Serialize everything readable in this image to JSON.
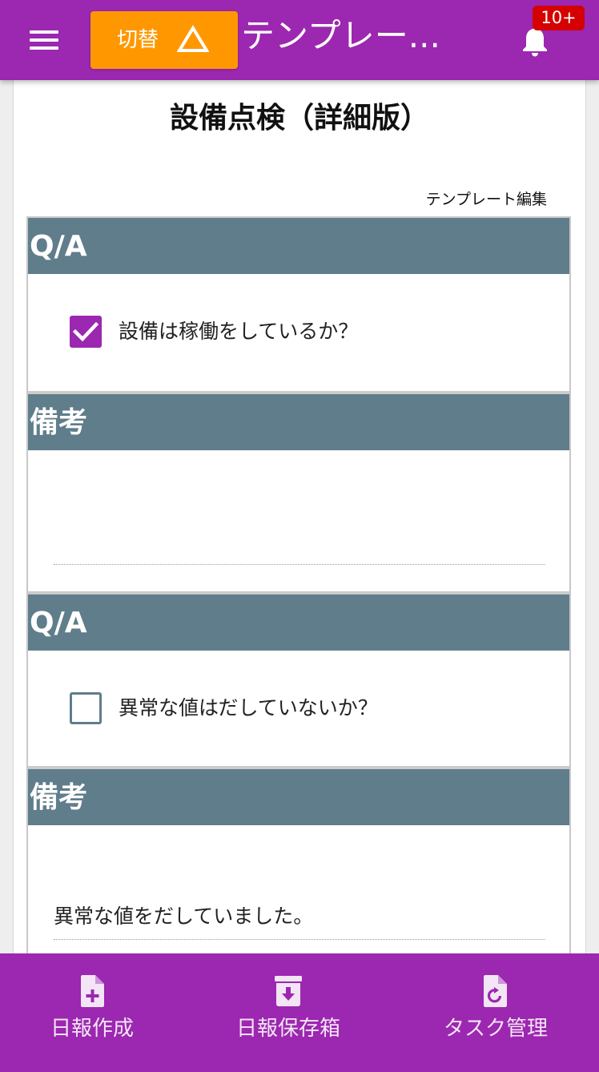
{
  "header": {
    "switch_label": "切替",
    "title": "テンプレー...",
    "notification_count": "10+",
    "icons": [
      "menu-icon",
      "warning-triangle-icon",
      "bell-icon"
    ],
    "bar_color": "#9c27b0",
    "switch_color": "#ff9800",
    "badge_color": "#d50000"
  },
  "card": {
    "title": "設備点検（詳細版）",
    "template_edit_label": "テンプレート編集"
  },
  "sections": [
    {
      "type": "qa",
      "header": "Q/A",
      "question": "設備は稼働をしているか？",
      "checked": true
    },
    {
      "type": "remark",
      "header": "備考",
      "value": ""
    },
    {
      "type": "qa",
      "header": "Q/A",
      "question": "異常な値はだしていないか？",
      "checked": false
    },
    {
      "type": "remark",
      "header": "備考",
      "value": "異常な値をだしていました。"
    }
  ],
  "section_header_color": "#607d8b",
  "bottom_nav": {
    "items": [
      {
        "label": "日報作成",
        "icon": "file-add-icon"
      },
      {
        "label": "日報保存箱",
        "icon": "archive-box-icon"
      },
      {
        "label": "タスク管理",
        "icon": "file-refresh-icon"
      }
    ]
  }
}
